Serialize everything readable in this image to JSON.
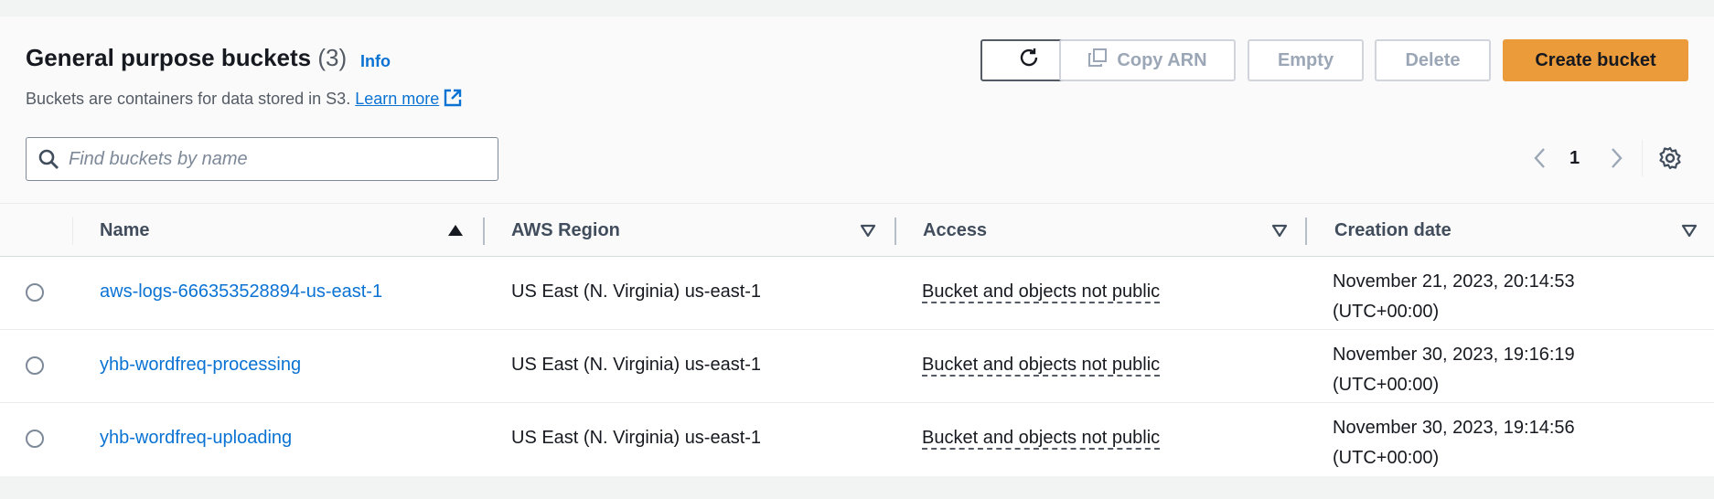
{
  "header": {
    "title": "General purpose buckets",
    "count": "(3)",
    "info_label": "Info",
    "description": "Buckets are containers for data stored in S3.",
    "learn_more": "Learn more"
  },
  "toolbar": {
    "copy_arn_label": "Copy ARN",
    "empty_label": "Empty",
    "delete_label": "Delete",
    "create_label": "Create bucket"
  },
  "search": {
    "placeholder": "Find buckets by name",
    "value": ""
  },
  "pagination": {
    "current_page": "1"
  },
  "table": {
    "columns": [
      "Name",
      "AWS Region",
      "Access",
      "Creation date"
    ],
    "sorted_column": "Name",
    "rows": [
      {
        "name": "aws-logs-666353528894-us-east-1",
        "region": "US East (N. Virginia) us-east-1",
        "access": "Bucket and objects not public",
        "date_line1": "November 21, 2023, 20:14:53",
        "date_line2": "(UTC+00:00)"
      },
      {
        "name": "yhb-wordfreq-processing",
        "region": "US East (N. Virginia) us-east-1",
        "access": "Bucket and objects not public",
        "date_line1": "November 30, 2023, 19:16:19",
        "date_line2": "(UTC+00:00)"
      },
      {
        "name": "yhb-wordfreq-uploading",
        "region": "US East (N. Virginia) us-east-1",
        "access": "Bucket and objects not public",
        "date_line1": "November 30, 2023, 19:14:56",
        "date_line2": "(UTC+00:00)"
      }
    ]
  },
  "icons": {
    "refresh": "refresh-icon",
    "copy": "copy-icon",
    "external": "external-link-icon",
    "search": "search-icon",
    "prev": "chevron-left-icon",
    "next": "chevron-right-icon",
    "settings": "gear-icon",
    "sort_asc": "caret-up-icon",
    "sort_none": "caret-down-outline-icon"
  },
  "colors": {
    "accent": "#0972d3",
    "primary_button": "#ec9b3b",
    "disabled_text": "#9ba7b6",
    "page_background": "#f2f3f3"
  }
}
